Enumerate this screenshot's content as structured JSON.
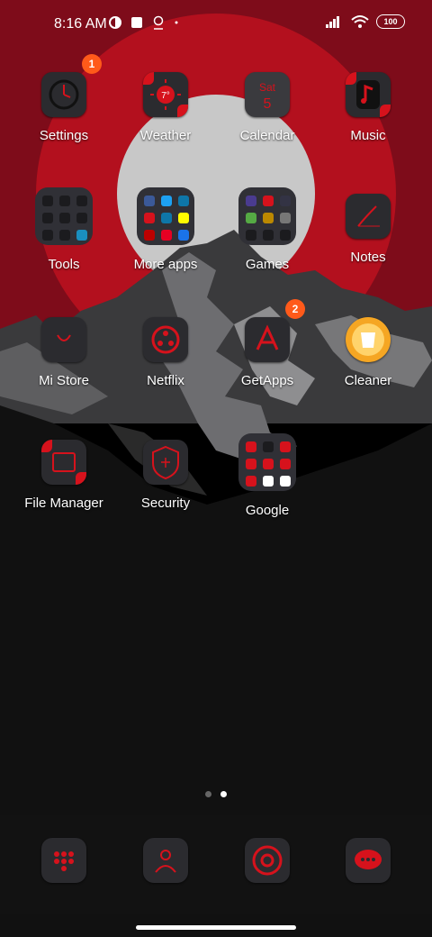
{
  "status": {
    "time": "8:16 AM",
    "battery": "100"
  },
  "apps": {
    "settings": {
      "label": "Settings",
      "badge": "1"
    },
    "weather": {
      "label": "Weather",
      "temp": "7°"
    },
    "calendar": {
      "label": "Calendar",
      "day": "Sat",
      "date": "5"
    },
    "music": {
      "label": "Music"
    },
    "tools": {
      "label": "Tools"
    },
    "more_apps": {
      "label": "More apps"
    },
    "games": {
      "label": "Games"
    },
    "notes": {
      "label": "Notes"
    },
    "mi_store": {
      "label": "Mi Store"
    },
    "netflix": {
      "label": "Netflix"
    },
    "getapps": {
      "label": "GetApps",
      "badge": "2"
    },
    "cleaner": {
      "label": "Cleaner"
    },
    "file_manager": {
      "label": "File Manager"
    },
    "security": {
      "label": "Security"
    },
    "google": {
      "label": "Google"
    }
  },
  "page_indicator": {
    "pages": 2,
    "current": 2
  },
  "theme": {
    "accent": "#d6121c",
    "badge": "#ff5a1a",
    "sky": "#8b0d1c",
    "sun": "#c8c8c8",
    "moon_ring": "#b3101e"
  }
}
